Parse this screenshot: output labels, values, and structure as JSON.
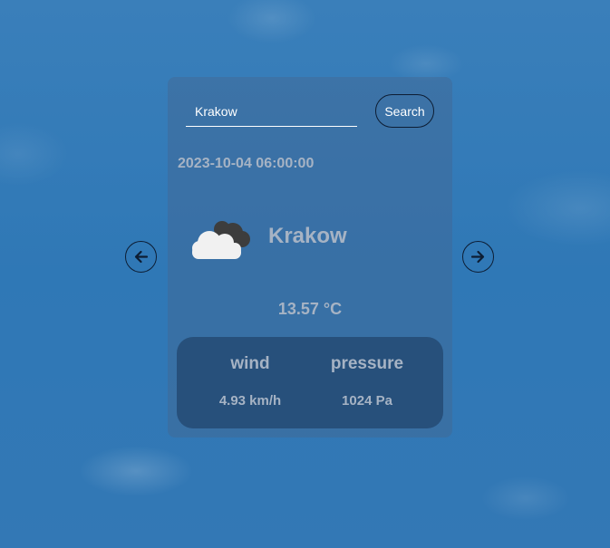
{
  "search": {
    "value": "Krakow",
    "button_label": "Search"
  },
  "weather": {
    "datetime": "2023-10-04 06:00:00",
    "city": "Krakow",
    "temperature": "13.57 °C",
    "condition_icon": "cloud-icon"
  },
  "stats": {
    "wind_label": "wind",
    "wind_value": "4.93 km/h",
    "pressure_label": "pressure",
    "pressure_value": "1024 Pa"
  },
  "navigation": {
    "prev_icon": "arrow-left-icon",
    "next_icon": "arrow-right-icon"
  },
  "colors": {
    "background": "#3378b5",
    "text_muted": "#a6b3c4",
    "border_dark": "#0d1d33"
  }
}
